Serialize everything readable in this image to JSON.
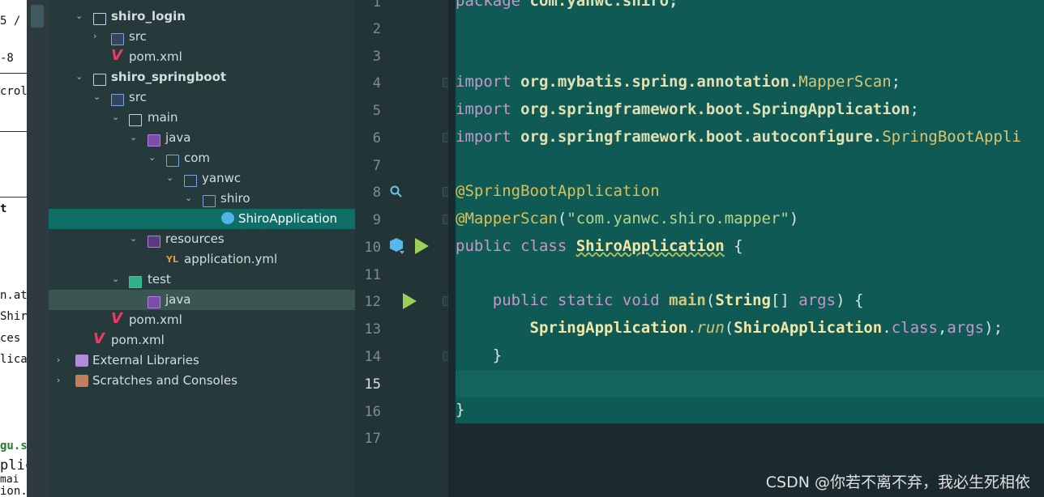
{
  "sliver": {
    "lines": [
      "5 /",
      "-8",
      "crol",
      "t",
      "n.atg",
      "Shiro",
      "ces",
      "licati",
      "gu.s",
      "plic",
      " mai",
      "ion."
    ]
  },
  "tree": {
    "items": [
      {
        "label": "shiro_login",
        "bold": true,
        "icon": "module-folder-icon"
      },
      {
        "label": "src",
        "icon": "source-folder-icon"
      },
      {
        "label": "pom.xml",
        "icon": "maven-icon"
      },
      {
        "label": "shiro_springboot",
        "bold": true,
        "icon": "module-folder-icon"
      },
      {
        "label": "src",
        "icon": "source-folder-icon"
      },
      {
        "label": "main",
        "icon": "folder-icon"
      },
      {
        "label": "java",
        "icon": "java-source-root-icon"
      },
      {
        "label": "com",
        "icon": "package-icon"
      },
      {
        "label": "yanwc",
        "icon": "package-icon"
      },
      {
        "label": "shiro",
        "icon": "package-icon"
      },
      {
        "label": "ShiroApplication",
        "icon": "spring-boot-class-icon"
      },
      {
        "label": "resources",
        "icon": "resources-folder-icon"
      },
      {
        "label": "application.yml",
        "icon": "yaml-file-icon"
      },
      {
        "label": "test",
        "icon": "test-folder-icon"
      },
      {
        "label": "java",
        "icon": "java-test-root-icon"
      },
      {
        "label": "pom.xml",
        "icon": "maven-icon"
      },
      {
        "label": "pom.xml",
        "icon": "maven-icon"
      },
      {
        "label": "External Libraries",
        "icon": "library-icon"
      },
      {
        "label": "Scratches and Consoles",
        "icon": "scratches-icon"
      }
    ]
  },
  "gutter": {
    "lines": [
      "1",
      "2",
      "3",
      "4",
      "5",
      "6",
      "7",
      "8",
      "9",
      "10",
      "11",
      "12",
      "13",
      "14",
      "15",
      "16",
      "17"
    ],
    "current_line": "15"
  },
  "code": {
    "l1": {
      "kw": "package",
      "rest": " com.yanwc.shiro;"
    },
    "l4": {
      "kw": "import",
      "pkg": " org.mybatis.spring.annotation.",
      "cls": "MapperScan",
      "end": ";"
    },
    "l5": {
      "kw": "import",
      "pkg": " org.springframework.boot.SpringApplication",
      "end": ";"
    },
    "l6": {
      "kw": "import",
      "pkg": " org.springframework.boot.autoconfigure.",
      "cls": "SpringBootAppli"
    },
    "l8": {
      "ann": "@SpringBootApplication"
    },
    "l9": {
      "ann": "@MapperScan",
      "p1": "(",
      "str": "\"com.yanwc.shiro.mapper\"",
      "p2": ")"
    },
    "l10": {
      "kw": "public class ",
      "cls": "ShiroApplication",
      "end": " {"
    },
    "l12": {
      "kw": "    public static void ",
      "fn": "main",
      "p1": "(",
      "type": "String",
      "p2": "[] ",
      "arg": "args",
      "p3": ") {"
    },
    "l13": {
      "indent": "        ",
      "cls": "SpringApplication",
      "dot": ".",
      "fn": "run",
      "p1": "(",
      "cls2": "ShiroApplication",
      "dot2": ".",
      "kw": "class",
      "p2": ",",
      "arg": "args",
      "p3": ");"
    },
    "l14": "    }",
    "l16": "}"
  },
  "watermark": "CSDN @你若不离不弃，我必生死相依",
  "colors": {
    "editor_bg": "#0f5a55",
    "tree_bg": "#26393b",
    "selection": "#0f6e66",
    "keyword": "#c896c8",
    "annotation": "#d7c05a",
    "run_icon": "#9ccf57"
  }
}
